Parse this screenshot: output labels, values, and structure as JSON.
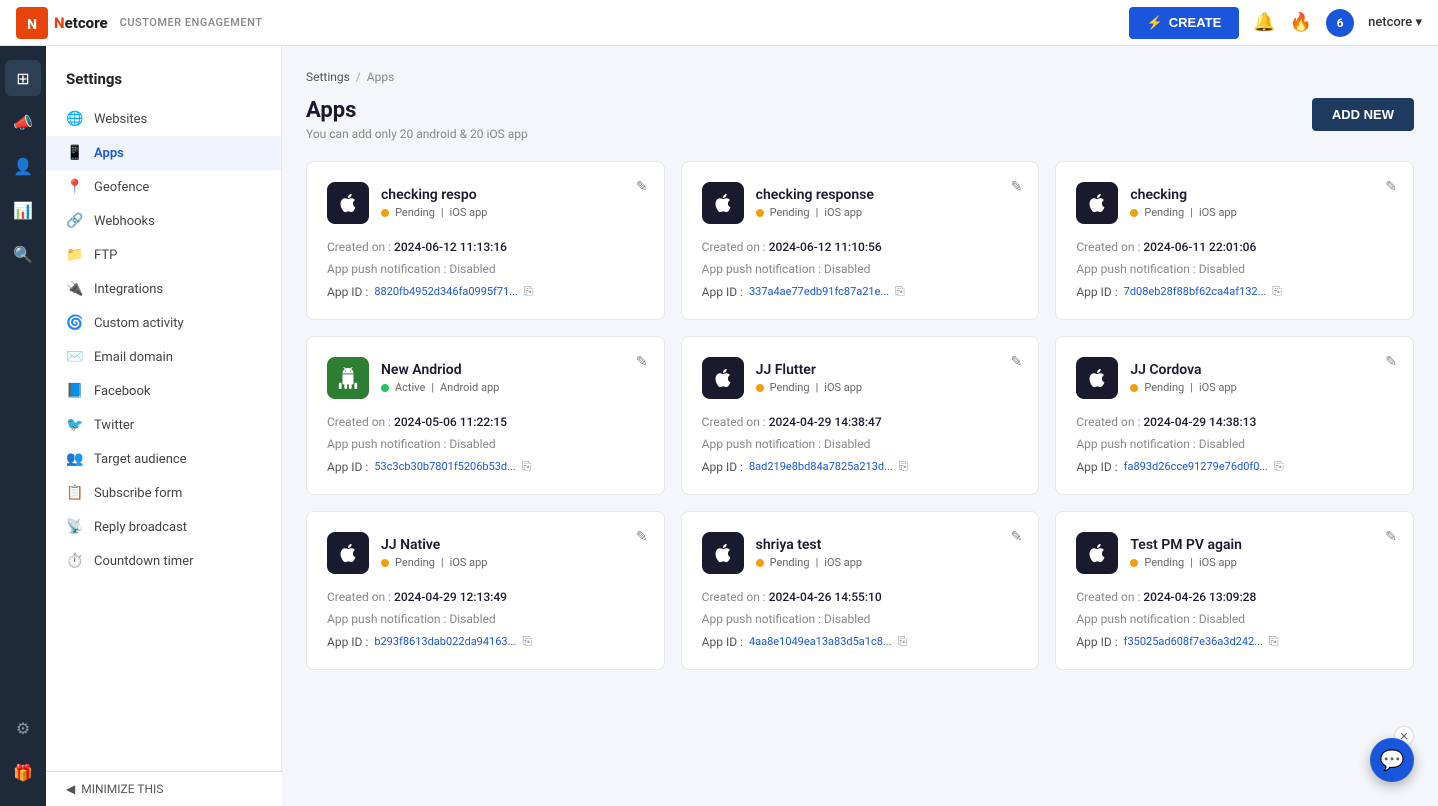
{
  "brand": {
    "name": "Netcore",
    "subtext": "CUSTOMER ENGAGEMENT"
  },
  "topnav": {
    "create_label": "CREATE",
    "notification_icon": "🔔",
    "fire_icon": "🔥",
    "avatar_label": "6",
    "user_label": "netcore ▾"
  },
  "sidebar": {
    "title": "Settings",
    "items": [
      {
        "label": "Websites",
        "icon": "🌐",
        "active": false
      },
      {
        "label": "Apps",
        "icon": "📱",
        "active": true
      },
      {
        "label": "Geofence",
        "icon": "📍",
        "active": false
      },
      {
        "label": "Webhooks",
        "icon": "🔗",
        "active": false
      },
      {
        "label": "FTP",
        "icon": "📁",
        "active": false
      },
      {
        "label": "Integrations",
        "icon": "🔌",
        "active": false
      },
      {
        "label": "Custom activity",
        "icon": "🌀",
        "active": false
      },
      {
        "label": "Email domain",
        "icon": "✉️",
        "active": false
      },
      {
        "label": "Facebook",
        "icon": "📘",
        "active": false
      },
      {
        "label": "Twitter",
        "icon": "🐦",
        "active": false
      },
      {
        "label": "Target audience",
        "icon": "👥",
        "active": false
      },
      {
        "label": "Subscribe form",
        "icon": "📋",
        "active": false
      },
      {
        "label": "Reply broadcast",
        "icon": "📡",
        "active": false
      },
      {
        "label": "Countdown timer",
        "icon": "⏱️",
        "active": false
      }
    ]
  },
  "breadcrumb": {
    "items": [
      "Settings",
      "Apps"
    ]
  },
  "page": {
    "title": "Apps",
    "subtitle": "You can add only 20 android & 20 iOS app",
    "add_new_label": "ADD NEW"
  },
  "apps": [
    {
      "name": "checking respo",
      "status": "Pending",
      "status_type": "pending",
      "platform": "iOS app",
      "platform_icon": "apple",
      "created_on": "2024-06-12 11:13:16",
      "push_notification": "Disabled",
      "app_id": "8820fb4952d346fa0995f71..."
    },
    {
      "name": "checking response",
      "status": "Pending",
      "status_type": "pending",
      "platform": "iOS app",
      "platform_icon": "apple",
      "created_on": "2024-06-12 11:10:56",
      "push_notification": "Disabled",
      "app_id": "337a4ae77edb91fc87a21e..."
    },
    {
      "name": "checking",
      "status": "Pending",
      "status_type": "pending",
      "platform": "iOS app",
      "platform_icon": "apple",
      "created_on": "2024-06-11 22:01:06",
      "push_notification": "Disabled",
      "app_id": "7d08eb28f88bf62ca4af132..."
    },
    {
      "name": "New Andriod",
      "status": "Active",
      "status_type": "active",
      "platform": "Android app",
      "platform_icon": "android",
      "created_on": "2024-05-06 11:22:15",
      "push_notification": "Disabled",
      "app_id": "53c3cb30b7801f5206b53d..."
    },
    {
      "name": "JJ Flutter",
      "status": "Pending",
      "status_type": "pending",
      "platform": "iOS app",
      "platform_icon": "apple",
      "created_on": "2024-04-29 14:38:47",
      "push_notification": "Disabled",
      "app_id": "8ad219e8bd84a7825a213d..."
    },
    {
      "name": "JJ Cordova",
      "status": "Pending",
      "status_type": "pending",
      "platform": "iOS app",
      "platform_icon": "apple",
      "created_on": "2024-04-29 14:38:13",
      "push_notification": "Disabled",
      "app_id": "fa893d26cce91279e76d0f0..."
    },
    {
      "name": "JJ Native",
      "status": "Pending",
      "status_type": "pending",
      "platform": "iOS app",
      "platform_icon": "apple",
      "created_on": "2024-04-29 12:13:49",
      "push_notification": "Disabled",
      "app_id": "b293f8613dab022da94163..."
    },
    {
      "name": "shriya test",
      "status": "Pending",
      "status_type": "pending",
      "platform": "iOS app",
      "platform_icon": "apple",
      "created_on": "2024-04-26 14:55:10",
      "push_notification": "Disabled",
      "app_id": "4aa8e1049ea13a83d5a1c8..."
    },
    {
      "name": "Test PM PV again",
      "status": "Pending",
      "status_type": "pending",
      "platform": "iOS app",
      "platform_icon": "apple",
      "created_on": "2024-04-26 13:09:28",
      "push_notification": "Disabled",
      "app_id": "f35025ad608f7e36a3d242..."
    }
  ],
  "labels": {
    "created_on": "Created on :",
    "push_notif": "App push notification :",
    "app_id": "App ID :"
  },
  "minimize": "MINIMIZE THIS",
  "chat_icon": "💬"
}
